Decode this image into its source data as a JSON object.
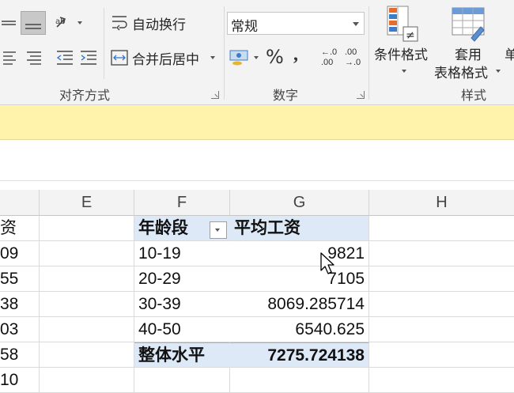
{
  "ribbon": {
    "wrap_text": "自动换行",
    "merge_center": "合并后居中",
    "number_format": "常规",
    "percent_symbol": "%",
    "comma_symbol": "͗",
    "conditional_format": "条件格式",
    "table_format_line1": "套用",
    "table_format_line2": "表格格式",
    "cut_label": "单",
    "groups": {
      "alignment": "对齐方式",
      "number": "数字",
      "styles": "样式"
    }
  },
  "columns": {
    "e": "E",
    "f": "F",
    "g": "G",
    "h": "H"
  },
  "left_cells": [
    "资",
    "09",
    "55",
    "38",
    "03",
    "58",
    "10"
  ],
  "pivot": {
    "header_label": "年龄段",
    "header_value": "平均工资",
    "rows": [
      {
        "label": "10-19",
        "value": "9821"
      },
      {
        "label": "20-29",
        "value": "7105"
      },
      {
        "label": "30-39",
        "value": "8069.285714"
      },
      {
        "label": "40-50",
        "value": "6540.625"
      }
    ],
    "total_label": "整体水平",
    "total_value": "7275.724138"
  },
  "colors": {
    "pivot_header_bg": "#dde9f7",
    "info_bar_bg": "#fff2ab",
    "ribbon_bg": "#f3f3f3"
  }
}
